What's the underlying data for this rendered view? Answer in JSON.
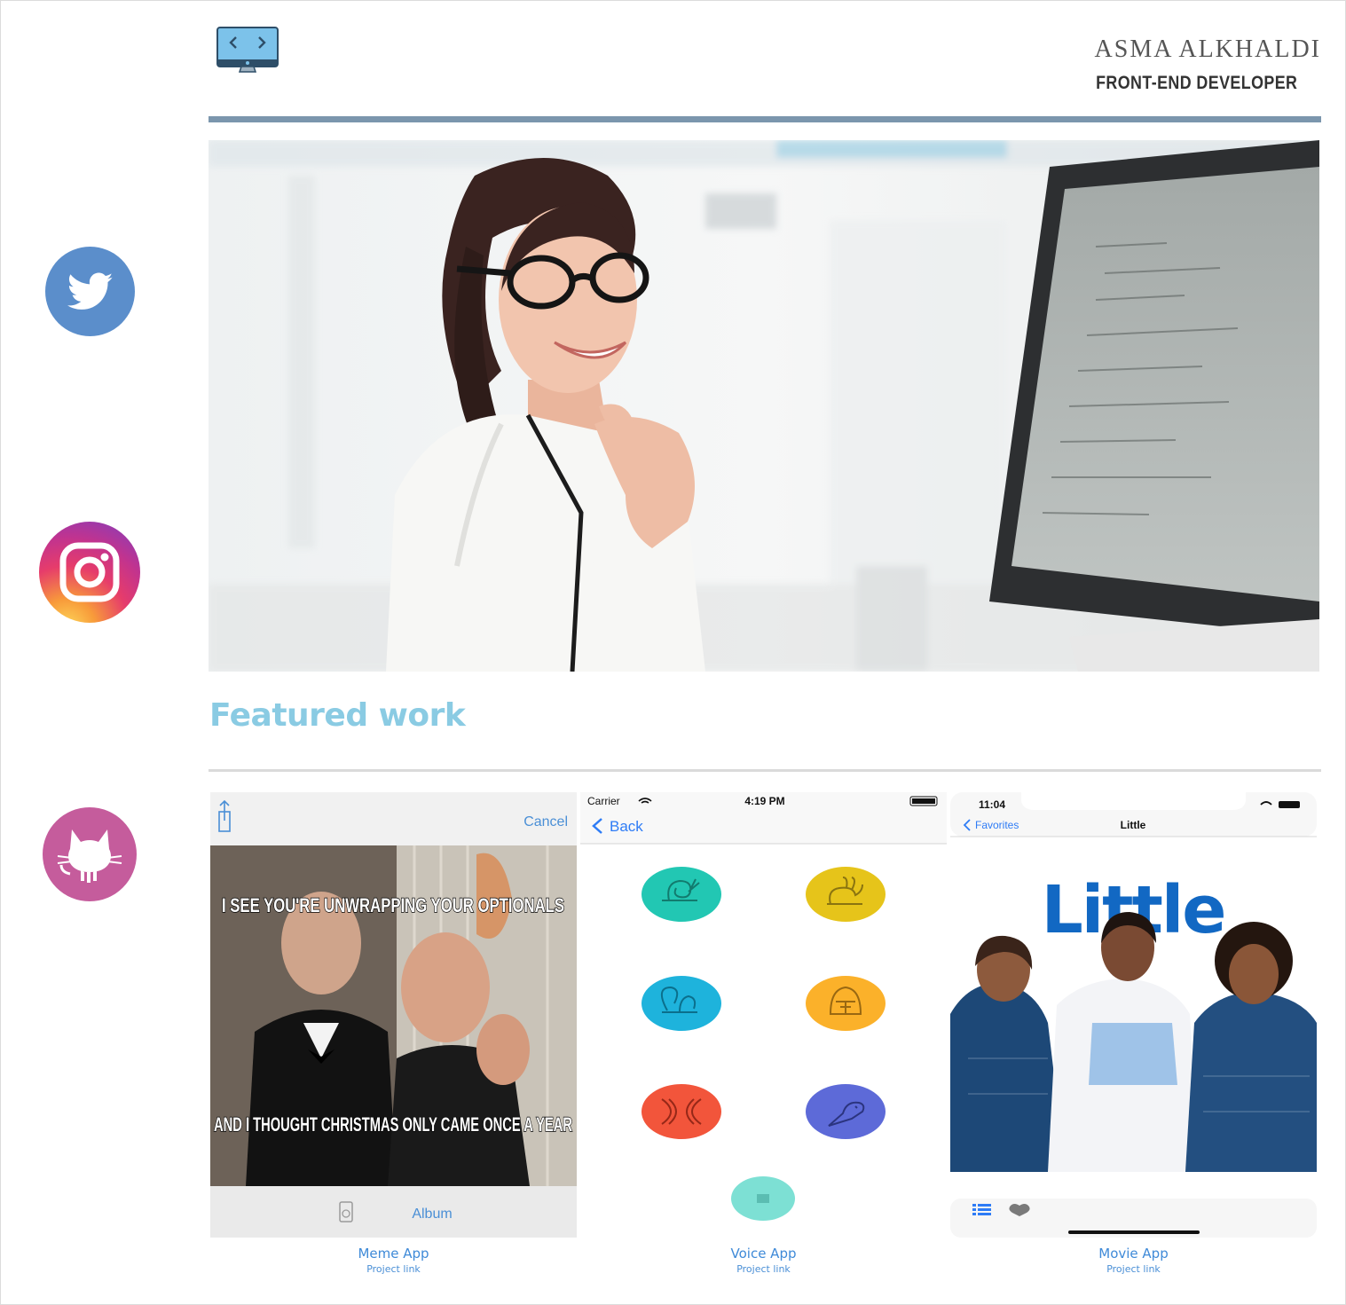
{
  "header": {
    "name": "ASMA ALKHALDI",
    "role": "FRONT-END DEVELOPER",
    "logo_icon": "monitor-code-icon"
  },
  "social": [
    {
      "name": "twitter",
      "icon": "twitter-icon",
      "color": "#5b8ecb"
    },
    {
      "name": "instagram",
      "icon": "instagram-icon",
      "color": "#e63c6b"
    },
    {
      "name": "github",
      "icon": "github-octocat-icon",
      "color": "#c55c9c"
    }
  ],
  "featured": {
    "title": "Featured work",
    "accent": "#8acbe3"
  },
  "projects": [
    {
      "title": "Meme App",
      "link": "Project link",
      "screen": {
        "cancel": "Cancel",
        "top_text": "I SEE YOU'RE UNWRAPPING YOUR OPTIONALS",
        "bottom_text": "AND I THOUGHT CHRISTMAS ONLY CAME ONCE A YEAR",
        "album": "Album"
      }
    },
    {
      "title": "Voice App",
      "link": "Project link",
      "screen": {
        "carrier": "Carrier",
        "time": "4:19 PM",
        "back": "Back",
        "buttons": [
          "snail",
          "rabbit",
          "squirrel",
          "darth-vader",
          "echo",
          "parrot"
        ],
        "colors": [
          "#22c7b3",
          "#e6c41a",
          "#1eb3dc",
          "#fbb12a",
          "#f2553b",
          "#5d6ad8"
        ]
      }
    },
    {
      "title": "Movie App",
      "link": "Project link",
      "screen": {
        "time": "11:04",
        "back": "Favorites",
        "nav_title": "Little",
        "poster_title": "Little"
      }
    }
  ]
}
